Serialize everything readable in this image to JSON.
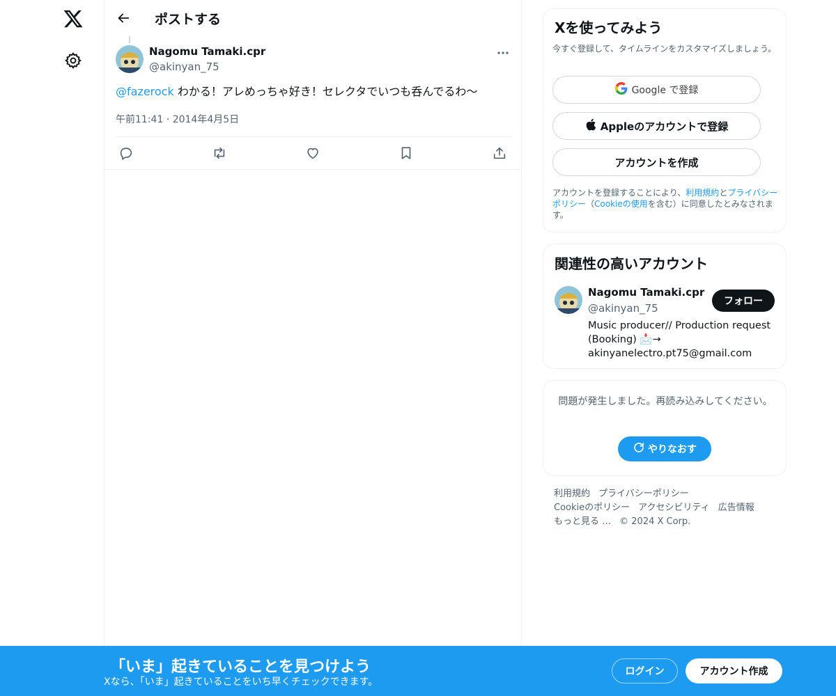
{
  "header": {
    "title": "ポストする"
  },
  "post": {
    "author_name": "Nagomu Tamaki.cpr",
    "author_handle": "@akinyan_75",
    "mention": "@fazerock",
    "text": " わかる！アレめっちゃ好き！セレクタでいつも呑んでるわ〜",
    "timestamp": "午前11:41 · 2014年4月5日"
  },
  "signup_card": {
    "title": "Xを使ってみよう",
    "subtitle": "今すぐ登録して、タイムラインをカスタマイズしましょう。",
    "google_label": "Google で登録",
    "apple_label": "Appleのアカウントで登録",
    "create_label": "アカウントを作成",
    "legal_prefix": "アカウントを登録することにより、",
    "terms_link": "利用規約",
    "legal_and": "と",
    "privacy_link": "プライバシーポリシー",
    "legal_paren_open": "（",
    "cookie_link": "Cookieの使用",
    "legal_suffix": "を含む）に同意したとみなされます。"
  },
  "related_card": {
    "title": "関連性の高いアカウント",
    "name": "Nagomu Tamaki.cpr",
    "handle": "@akinyan_75",
    "follow_label": "フォロー",
    "bio": "Music producer// Production request (Booking) 📩→ akinyanelectro.pt75@gmail.com"
  },
  "error_card": {
    "message": "問題が発生しました。再読み込みしてください。",
    "retry_label": "やりなおす"
  },
  "footer": {
    "terms": "利用規約",
    "privacy": "プライバシーポリシー",
    "cookie": "Cookieのポリシー",
    "accessibility": "アクセシビリティ",
    "ads": "広告情報",
    "more": "もっと見る …",
    "copyright": "© 2024 X Corp."
  },
  "banner": {
    "title": "「いま」起きていることを見つけよう",
    "subtitle": "Xなら、「いま」起きていることをいち早くチェックできます。",
    "login_label": "ログイン",
    "signup_label": "アカウント作成"
  },
  "colors": {
    "accent": "#1d9bf0",
    "text": "#0f1419",
    "secondary": "#536471",
    "border": "#eff3f4"
  },
  "icons": [
    "x-logo-icon",
    "settings-icon",
    "back-arrow-icon",
    "more-icon",
    "reply-icon",
    "repost-icon",
    "like-icon",
    "bookmark-icon",
    "share-icon",
    "google-icon",
    "apple-icon",
    "refresh-icon"
  ]
}
